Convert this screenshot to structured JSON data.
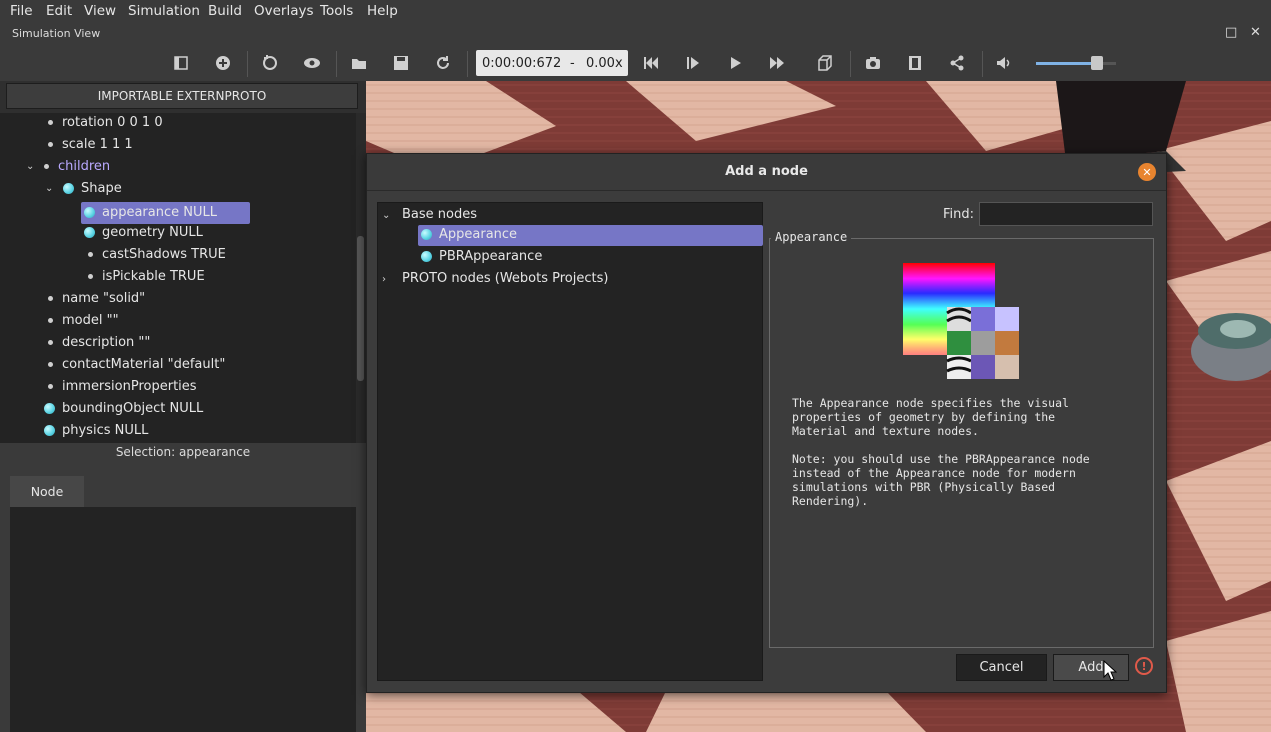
{
  "menu": [
    "File",
    "Edit",
    "View",
    "Simulation",
    "Build",
    "Overlays",
    "Tools",
    "Help"
  ],
  "window": {
    "title": "Simulation View"
  },
  "toolbar": {
    "time": "0:00:00:672",
    "time_sep": "-",
    "speed": "0.00x",
    "volume": 0.78
  },
  "scene_tree": {
    "import_button": "IMPORTABLE EXTERNPROTO",
    "items": [
      {
        "label": "rotation 0 0 1 0",
        "kind": "field"
      },
      {
        "label": "scale 1 1 1",
        "kind": "field"
      },
      {
        "label": "children",
        "kind": "group"
      },
      {
        "label": "Shape",
        "kind": "node"
      },
      {
        "label": "appearance NULL",
        "kind": "node",
        "selected": true
      },
      {
        "label": "geometry NULL",
        "kind": "node"
      },
      {
        "label": "castShadows TRUE",
        "kind": "field"
      },
      {
        "label": "isPickable TRUE",
        "kind": "field"
      },
      {
        "label": "name \"solid\"",
        "kind": "field"
      },
      {
        "label": "model \"\"",
        "kind": "field"
      },
      {
        "label": "description \"\"",
        "kind": "field"
      },
      {
        "label": "contactMaterial \"default\"",
        "kind": "field"
      },
      {
        "label": "immersionProperties",
        "kind": "field"
      },
      {
        "label": "boundingObject NULL",
        "kind": "node"
      },
      {
        "label": "physics NULL",
        "kind": "node"
      }
    ],
    "selection": "Selection: appearance",
    "tab": "Node"
  },
  "dialog": {
    "title": "Add a node",
    "tree": {
      "base_nodes": "Base nodes",
      "appearance": "Appearance",
      "pbr_appearance": "PBRAppearance",
      "proto_nodes": "PROTO nodes (Webots Projects)"
    },
    "find_label": "Find:",
    "find_value": "",
    "info_title": "Appearance",
    "description": "The Appearance node specifies the visual\nproperties of geometry by defining the\nMaterial and texture nodes.\n\nNote: you should use the PBRAppearance node\ninstead of the Appearance node for modern\nsimulations with PBR (Physically Based\nRendering).",
    "cancel": "Cancel",
    "add": "Add"
  },
  "colors": {
    "accent": "#7a73c9",
    "selection": "#7676c6",
    "close": "#e8842f",
    "warning": "#e05a4a"
  }
}
